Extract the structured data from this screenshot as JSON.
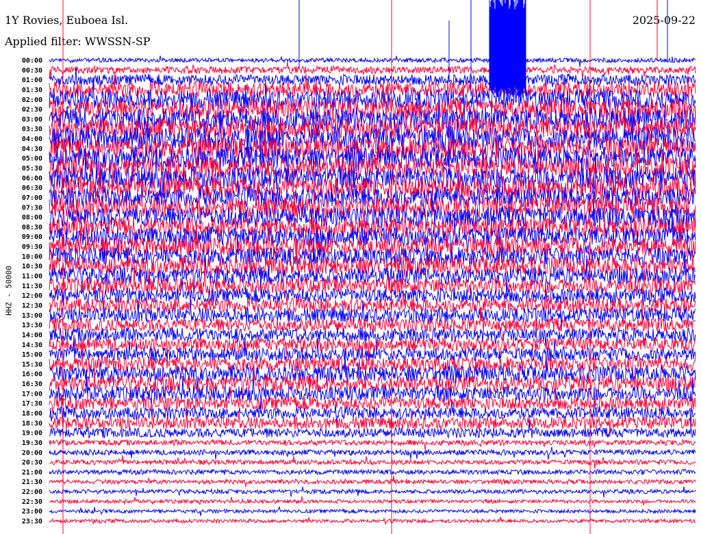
{
  "header": {
    "station": "1Y Rovies, Euboea Isl.",
    "filter": "Applied filter: WWSSN-SP",
    "date": "2025-09-22"
  },
  "chart_data": {
    "type": "line",
    "title": "1Y Rovies, Euboea Isl.",
    "ylabel": "HHZ - 50000",
    "xlabel": "",
    "colors": [
      "#0000ff",
      "#ff0033"
    ],
    "row_labels": [
      "00:00",
      "00:30",
      "01:00",
      "01:30",
      "02:00",
      "02:30",
      "03:00",
      "03:30",
      "04:00",
      "04:30",
      "05:00",
      "05:30",
      "06:00",
      "06:30",
      "07:00",
      "07:30",
      "08:00",
      "08:30",
      "09:00",
      "09:30",
      "10:00",
      "10:30",
      "11:00",
      "11:30",
      "12:00",
      "12:30",
      "13:00",
      "13:30",
      "14:00",
      "14:30",
      "15:00",
      "15:30",
      "16:00",
      "16:30",
      "17:00",
      "17:30",
      "18:00",
      "18:30",
      "19:00",
      "19:30",
      "20:00",
      "20:30",
      "21:00",
      "21:30",
      "22:00",
      "22:30",
      "23:00",
      "23:30"
    ],
    "relative_amplitude": [
      0.35,
      0.6,
      0.9,
      1.3,
      1.6,
      1.7,
      1.8,
      1.8,
      1.9,
      1.9,
      1.8,
      1.8,
      1.8,
      1.8,
      1.7,
      1.7,
      1.7,
      1.6,
      1.6,
      1.6,
      1.5,
      1.5,
      1.4,
      1.3,
      1.2,
      1.2,
      1.2,
      1.1,
      1.1,
      1.1,
      1.1,
      1.2,
      1.3,
      1.3,
      1.2,
      1.1,
      1.0,
      1.0,
      0.8,
      0.45,
      0.45,
      0.4,
      0.4,
      0.35,
      0.35,
      0.3,
      0.3,
      0.3
    ]
  }
}
